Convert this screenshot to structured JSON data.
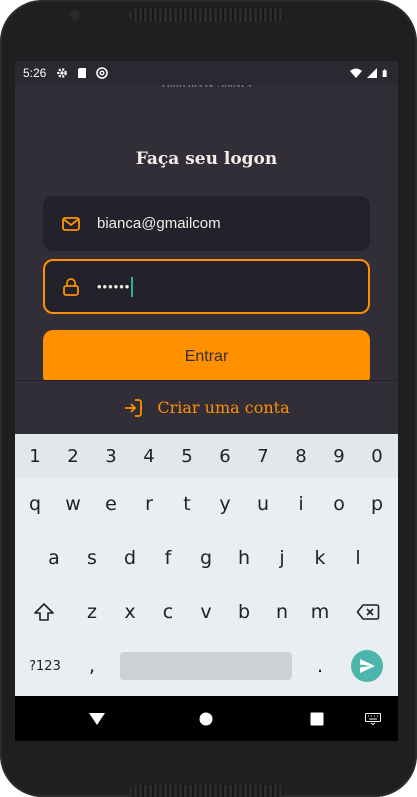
{
  "status_bar": {
    "time": "5:26",
    "left_icons": [
      "gear-icon",
      "sd-card-icon",
      "at-sign-icon"
    ],
    "right_icons": [
      "wifi-icon",
      "signal-icon",
      "battery-icon"
    ]
  },
  "brand": {
    "subtitle": "Haircuts & Shaves"
  },
  "login": {
    "title": "Faça seu logon",
    "email": {
      "value": "bianca@gmailcom",
      "icon": "mail-icon"
    },
    "password": {
      "value": "••••••",
      "icon": "lock-icon"
    },
    "submit_label": "Entrar"
  },
  "create_account": {
    "label": "Criar uma conta",
    "icon": "log-in-icon"
  },
  "keyboard": {
    "numbers": [
      "1",
      "2",
      "3",
      "4",
      "5",
      "6",
      "7",
      "8",
      "9",
      "0"
    ],
    "row1": [
      "q",
      "w",
      "e",
      "r",
      "t",
      "y",
      "u",
      "i",
      "o",
      "p"
    ],
    "row2": [
      "a",
      "s",
      "d",
      "f",
      "g",
      "h",
      "j",
      "k",
      "l"
    ],
    "row3": [
      "z",
      "x",
      "c",
      "v",
      "b",
      "n",
      "m"
    ],
    "symbols_label": "?123",
    "comma": ",",
    "period": "."
  },
  "colors": {
    "background": "#312e38",
    "input_bg": "#232129",
    "accent": "#ff9000",
    "text": "#f4ede8",
    "send_key": "#4db6ac"
  }
}
